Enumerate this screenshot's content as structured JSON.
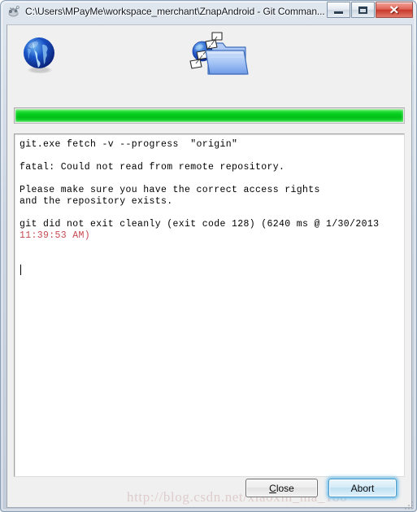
{
  "window": {
    "title": "C:\\Users\\MPayMe\\workspace_merchant\\ZnapAndroid - Git Comman...",
    "icon": "git-gui-icon",
    "controls": {
      "minimize_label": "Minimize",
      "maximize_label": "Maximize",
      "close_label": "Close"
    }
  },
  "animation": {
    "left_icon": "globe-icon",
    "center_icon": "file-copy-to-folder-icon"
  },
  "progress": {
    "percent": 100,
    "fill_color": "#00c417",
    "track_color": "#e8e8e8"
  },
  "console": {
    "lines": [
      "git.exe fetch -v --progress  \"origin\"",
      "",
      "fatal: Could not read from remote repository.",
      "",
      "Please make sure you have the correct access rights",
      "and the repository exists.",
      "",
      "git did not exit cleanly (exit code 128) (6240 ms @ 1/30/2013"
    ],
    "error_line": "11:39:53 AM)",
    "error_color": "#c74a52",
    "text_color": "#000000",
    "background": "#ffffff"
  },
  "footer": {
    "close_button": {
      "label": "Close",
      "accelerator": "C",
      "label_rest": "lose"
    },
    "abort_button": {
      "label": "Abort",
      "is_default": true,
      "glow_color": "#6ebeeb"
    }
  },
  "watermark": {
    "text": "http://blog.csdn.net/xiaoxin_ma_180"
  }
}
